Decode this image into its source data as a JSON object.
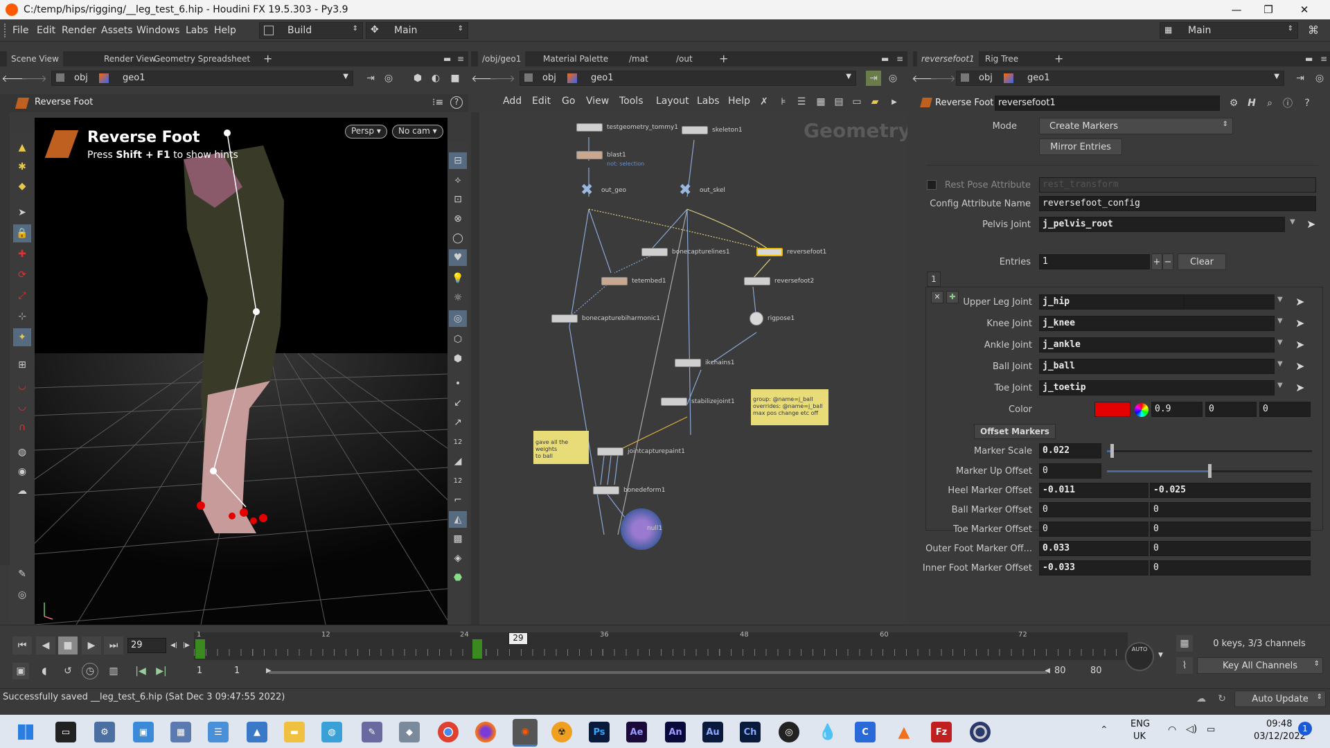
{
  "window": {
    "title": "C:/temp/hips/rigging/__leg_test_6.hip - Houdini FX 19.5.303 - Py3.9"
  },
  "menu": [
    "File",
    "Edit",
    "Render",
    "Assets",
    "Windows",
    "Labs",
    "Help"
  ],
  "desktop_combo": "Build",
  "desk_combo": "Main",
  "right_combo": "Main",
  "left_pane": {
    "tabs": [
      "Scene View",
      "Render View",
      "Geometry Spreadsheet"
    ],
    "path": [
      "obj",
      "geo1"
    ],
    "tool_title": "Reverse Foot",
    "hint_title": "Reverse Foot",
    "hint_text_pre": "Press",
    "hint_keys": "Shift + F1",
    "hint_text_post": "to show hints",
    "persp_btn": "Persp",
    "cam_btn": "No cam"
  },
  "mid_pane": {
    "tabs": [
      "/obj/geo1",
      "Material Palette",
      "/mat",
      "/out"
    ],
    "path": [
      "obj",
      "geo1"
    ],
    "menu": [
      "Add",
      "Edit",
      "Go",
      "View",
      "Tools",
      "Layout",
      "Labs",
      "Help"
    ],
    "watermark": "Geometry",
    "nodes": {
      "testgeometry": "testgeometry_tommy1",
      "skeleton": "skeleton1",
      "blast": "blast1",
      "blast_sub": "not: selection",
      "out_geo": "out_geo",
      "out_skel": "out_skel",
      "bonecapturelines": "bonecapturelines1",
      "reversefoot1": "reversefoot1",
      "tetembed": "tetembed1",
      "reversefoot2": "reversefoot2",
      "bonecapturebiharmonic": "bonecapturebiharmonic1",
      "rigpose": "rigpose1",
      "ikchains": "ikchains1",
      "stabilizejoint": "stabilizejoint1",
      "jointcapturepaint": "jointcapturepaint1",
      "bonedeform": "bonedeform1",
      "null": "null1"
    },
    "sticky1": [
      "group: @name=j_ball",
      "overrides: @name=j_ball",
      "max pos change etc off"
    ],
    "sticky2": [
      "gave all the weights",
      "to ball"
    ]
  },
  "right_pane": {
    "tabs": [
      "reversefoot1",
      "Rig Tree"
    ],
    "path": [
      "obj",
      "geo1"
    ],
    "node_type": "Reverse Foot",
    "node_name": "reversefoot1",
    "mode_label": "Mode",
    "mode_value": "Create Markers",
    "mirror_btn": "Mirror Entries",
    "rest_pose_label": "Rest Pose Attribute",
    "rest_pose_value": "rest_transform",
    "config_label": "Config Attribute Name",
    "config_value": "reversefoot_config",
    "pelvis_label": "Pelvis Joint",
    "pelvis_value": "j_pelvis_root",
    "entries_label": "Entries",
    "entries_value": "1",
    "clear_btn": "Clear",
    "entry_tab": "1",
    "joints": [
      {
        "label": "Upper Leg Joint",
        "value": "j_hip"
      },
      {
        "label": "Knee Joint",
        "value": "j_knee"
      },
      {
        "label": "Ankle Joint",
        "value": "j_ankle"
      },
      {
        "label": "Ball Joint",
        "value": "j_ball"
      },
      {
        "label": "Toe Joint",
        "value": "j_toetip"
      }
    ],
    "color_label": "Color",
    "color_rgb": [
      "0.9",
      "0",
      "0"
    ],
    "offset_tab": "Offset Markers",
    "marker_scale_label": "Marker Scale",
    "marker_scale": "0.022",
    "marker_scale_fraction": 0.022,
    "marker_up_label": "Marker Up Offset",
    "marker_up": "0",
    "marker_up_fraction": 0.5,
    "offsets": [
      {
        "label": "Heel Marker Offset",
        "a": "-0.011",
        "b": "-0.025"
      },
      {
        "label": "Ball Marker Offset",
        "a": "0",
        "b": "0"
      },
      {
        "label": "Toe Marker Offset",
        "a": "0",
        "b": "0"
      },
      {
        "label": "Outer Foot Marker Off...",
        "a": "0.033",
        "b": "0"
      },
      {
        "label": "Inner Foot Marker Offset",
        "a": "-0.033",
        "b": "0"
      }
    ]
  },
  "timeline": {
    "frame": "29",
    "ticks": [
      "1",
      "12",
      "24",
      "29",
      "36",
      "48",
      "60",
      "72"
    ],
    "range_start": "1",
    "range_start2": "1",
    "range_end": "80",
    "range_end2": "80",
    "keys_info": "0 keys, 3/3 channels",
    "key_all": "Key All Channels",
    "auto_update": "Auto Update",
    "auto_label": "AUTO"
  },
  "status": "Successfully saved __leg_test_6.hip (Sat Dec  3 09:47:55 2022)",
  "taskbar": {
    "lang1": "ENG",
    "lang2": "UK",
    "time": "09:48",
    "date": "03/12/2022",
    "notif": "1",
    "apps": [
      "Ps",
      "Ae",
      "An",
      "Au",
      "Ch"
    ]
  },
  "colors": {
    "accent": "#ff5a00",
    "marker": "#e50000",
    "node_selected": "#f0c000"
  }
}
